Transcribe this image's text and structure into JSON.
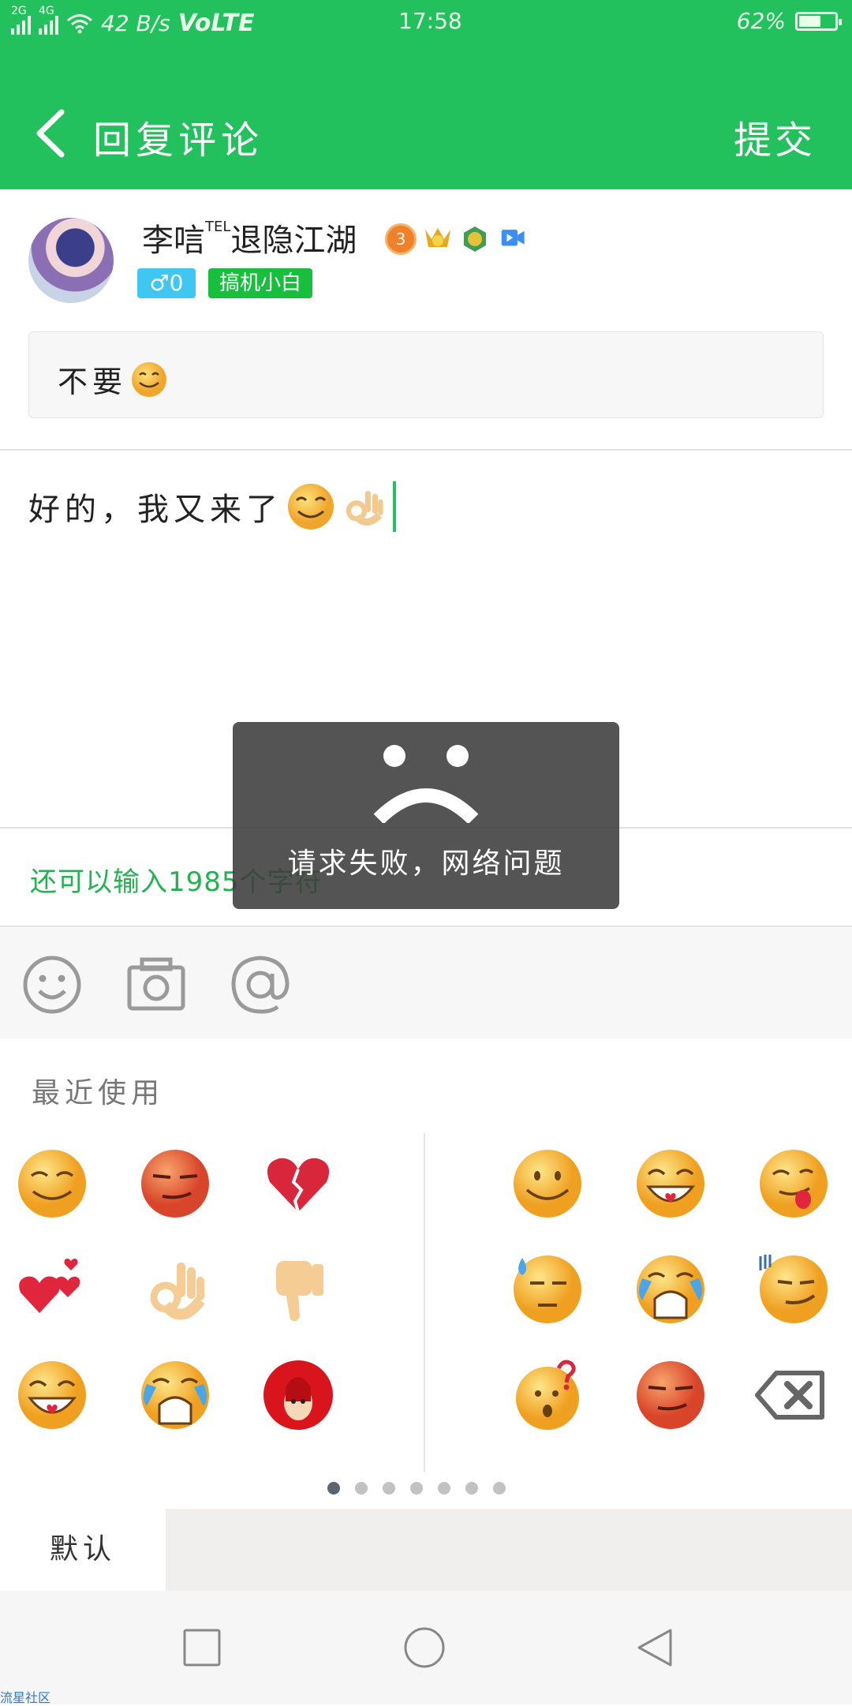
{
  "status_bar": {
    "net1": "2G",
    "net2": "4G",
    "speed": "42 B/s",
    "volte": "VoLTE",
    "time": "17:58",
    "battery": "62%",
    "battery_level": 0.62
  },
  "header": {
    "title": "回复评论",
    "submit": "提交",
    "bg_color": "#22c15e"
  },
  "user": {
    "name": "李唁",
    "name_sup": "TEL",
    "name_suffix": "退隐江湖",
    "level_badge": "3",
    "gender_tag": "♂0",
    "rank_tag": "搞机小白"
  },
  "quoted_comment": {
    "text": "不要"
  },
  "reply": {
    "text": "好的，我又来了"
  },
  "remaining_text": "还可以输入1985个字符",
  "toast": {
    "message": "请求失败，网络问题"
  },
  "emoji_panel": {
    "recent_label": "最近使用",
    "recent": [
      "smile-shy",
      "smirk-red",
      "broken-heart",
      "two-hearts",
      "ok-hand",
      "thumbs-down",
      "grin-tongue-heart",
      "cry",
      "red-hair-doll"
    ],
    "page": [
      "smile",
      "grin-heart",
      "tongue-out",
      "sweat",
      "cry",
      "speed-smirk",
      "confused",
      "smirk-red"
    ],
    "pages": 7,
    "active_page": 1
  },
  "tabs": {
    "default": "默认"
  },
  "watermark": "流星社区"
}
